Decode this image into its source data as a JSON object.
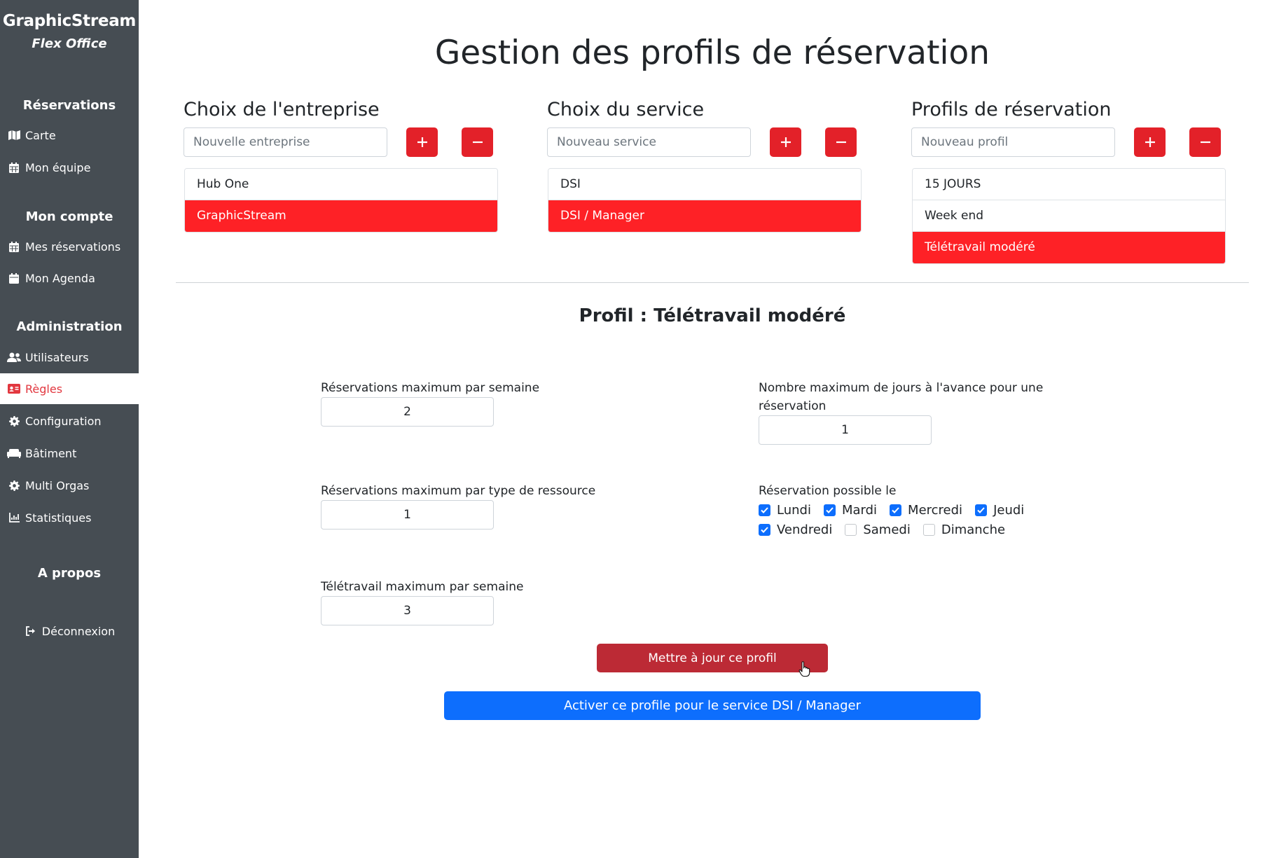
{
  "brand": {
    "title": "GraphicStream",
    "subtitle": "Flex Office"
  },
  "sidebar": {
    "sections": [
      {
        "title": "Réservations"
      },
      {
        "title": "Mon compte"
      },
      {
        "title": "Administration"
      },
      {
        "title": "A propos"
      }
    ],
    "items": [
      {
        "label": "Carte",
        "icon": "map-icon"
      },
      {
        "label": "Mon équipe",
        "icon": "calendar-icon"
      },
      {
        "label": "Mes réservations",
        "icon": "calendar-icon"
      },
      {
        "label": "Mon Agenda",
        "icon": "calendar-icon"
      },
      {
        "label": "Utilisateurs",
        "icon": "users-icon"
      },
      {
        "label": "Règles",
        "icon": "id-card-icon",
        "active": true
      },
      {
        "label": "Configuration",
        "icon": "gear-icon"
      },
      {
        "label": "Bâtiment",
        "icon": "couch-icon"
      },
      {
        "label": "Multi Orgas",
        "icon": "gear-icon"
      },
      {
        "label": "Statistiques",
        "icon": "chart-icon"
      },
      {
        "label": "Déconnexion",
        "icon": "sign-out-icon"
      }
    ]
  },
  "page": {
    "title": "Gestion des profils de réservation"
  },
  "company": {
    "title": "Choix de l'entreprise",
    "placeholder": "Nouvelle entreprise",
    "items": [
      "Hub One",
      "GraphicStream"
    ],
    "selected": "GraphicStream"
  },
  "service": {
    "title": "Choix du service",
    "placeholder": "Nouveau service",
    "items": [
      "DSI",
      "DSI / Manager"
    ],
    "selected": "DSI / Manager"
  },
  "profiles": {
    "title": "Profils de réservation",
    "placeholder": "Nouveau profil",
    "items": [
      "15 JOURS",
      "Week end",
      "Télétravail modéré"
    ],
    "selected": "Télétravail modéré"
  },
  "profile": {
    "heading": "Profil : Télétravail modéré",
    "max_per_week_label": "Réservations maximum par semaine",
    "max_per_week": "2",
    "max_days_ahead_label": "Nombre maximum de jours à l'avance pour une réservation",
    "max_days_ahead": "1",
    "max_per_resource_label": "Réservations maximum par type de ressource",
    "max_per_resource": "1",
    "days_label": "Réservation possible le",
    "days": [
      {
        "label": "Lundi",
        "checked": true
      },
      {
        "label": "Mardi",
        "checked": true
      },
      {
        "label": "Mercredi",
        "checked": true
      },
      {
        "label": "Jeudi",
        "checked": true
      },
      {
        "label": "Vendredi",
        "checked": true
      },
      {
        "label": "Samedi",
        "checked": false
      },
      {
        "label": "Dimanche",
        "checked": false
      }
    ],
    "telework_label": "Télétravail maximum par semaine",
    "telework_max": "3"
  },
  "buttons": {
    "update": "Mettre à jour ce profil",
    "activate": "Activer ce profile pour le service DSI / Manager"
  },
  "colors": {
    "sidebar_bg": "#464d53",
    "accent_red": "#fe2126",
    "button_red": "#e32129",
    "update_red": "#bc2a35",
    "primary_blue": "#0d6efd",
    "active_nav_text": "#e2373f"
  }
}
